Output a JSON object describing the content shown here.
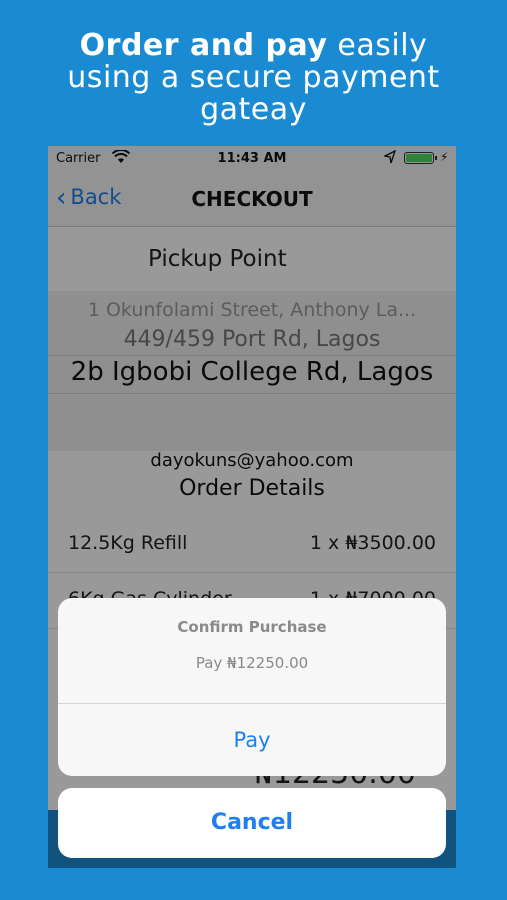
{
  "promo": {
    "headline_bold": "Order and pay",
    "headline_rest": " easily",
    "headline_line2": "using a secure payment",
    "headline_line3": "gateay"
  },
  "status_bar": {
    "carrier": "Carrier",
    "time": "11:43 AM",
    "battery_level": 1.0,
    "icons": [
      "wifi-icon",
      "location-arrow-icon",
      "battery-icon",
      "charging-bolt-icon"
    ]
  },
  "nav": {
    "back_label": "Back",
    "title": "CHECKOUT"
  },
  "checkout": {
    "pickup_label": "Pickup Point",
    "pickup_options": [
      "1 Okunfolami Street, Anthony La...",
      "449/459 Port Rd, Lagos",
      "2b Igbobi College Rd, Lagos"
    ],
    "selected_pickup": "2b Igbobi College Rd, Lagos",
    "email": "dayokuns@yahoo.com",
    "order_details_title": "Order Details",
    "items": [
      {
        "name": "12.5Kg Refill",
        "qty": "1 x ₦3500.00"
      },
      {
        "name": "6Kg Gas Cylinder",
        "qty": "1 x ₦7000.00"
      }
    ],
    "total_partial": "₦12250.00"
  },
  "alert": {
    "title": "Confirm Purchase",
    "message": "Pay ₦12250.00",
    "pay_label": "Pay",
    "cancel_label": "Cancel"
  },
  "colors": {
    "background": "#1a8bd3",
    "accent": "#1f7ef0",
    "battery": "#4cd964"
  }
}
